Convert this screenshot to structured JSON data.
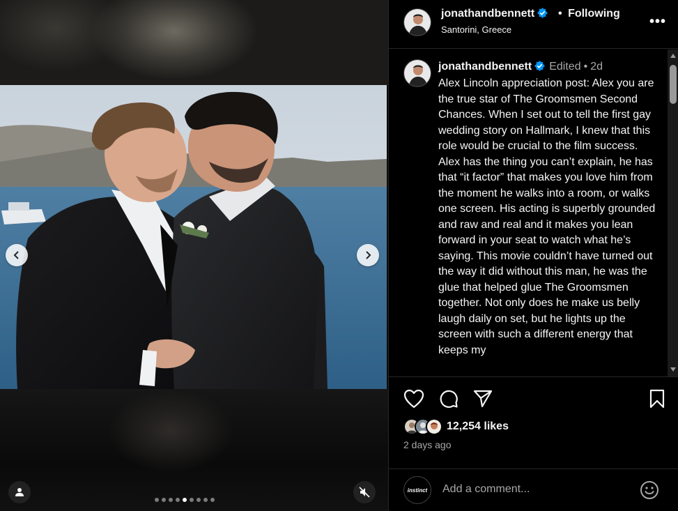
{
  "post": {
    "username": "jonathandbennett",
    "location": "Santorini, Greece",
    "follow_label": "Following",
    "bullet": "•",
    "more_label": "•••",
    "edited_label": "Edited",
    "age": "2d",
    "caption": "Alex Lincoln appreciation post: Alex you are the true star of The Groomsmen Second Chances. When I set out to tell the first gay wedding story on Hallmark, I knew that this role would be crucial to the film success. Alex has the thing you can’t explain, he has that “it factor” that makes you love him from the moment he walks into a room, or walks one screen. His acting is superbly grounded and raw and real and it makes you lean forward in your seat to watch what he’s saying. This movie couldn’t have turned out the way it did without this man, he was the glue that helped glue The Groomsmen together. Not only does he make us belly laugh daily on set, but he lights up the screen with such a different energy that keeps my",
    "likes": "12,254 likes",
    "timestamp": "2 days ago"
  },
  "media": {
    "slide_count": 9,
    "active_slide": 4,
    "prev_icon": "chevron-left-icon",
    "next_icon": "chevron-right-icon",
    "tag_icon": "person-tag-icon",
    "mute_icon": "speaker-muted-icon"
  },
  "actions": {
    "like_icon": "heart-icon",
    "comment_icon": "comment-icon",
    "share_icon": "paper-plane-icon",
    "save_icon": "bookmark-icon"
  },
  "comment_box": {
    "placeholder": "Add a comment...",
    "commenter_logo": "instinct",
    "emoji_icon": "smiley-icon"
  },
  "colors": {
    "background": "#000000",
    "text_primary": "#f5f5f5",
    "text_secondary": "#a8a8a8",
    "verified_blue": "#0095f6",
    "divider": "#262626"
  }
}
